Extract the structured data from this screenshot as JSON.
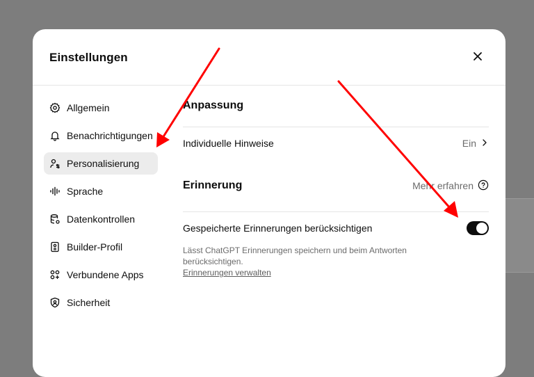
{
  "modal": {
    "title": "Einstellungen"
  },
  "sidebar": {
    "items": [
      {
        "label": "Allgemein",
        "icon": "gear-icon"
      },
      {
        "label": "Benachrichtigungen",
        "icon": "bell-icon"
      },
      {
        "label": "Personalisierung",
        "icon": "user-sliders-icon",
        "active": true
      },
      {
        "label": "Sprache",
        "icon": "waveform-icon"
      },
      {
        "label": "Datenkontrollen",
        "icon": "database-icon"
      },
      {
        "label": "Builder-Profil",
        "icon": "id-card-icon"
      },
      {
        "label": "Verbundene Apps",
        "icon": "apps-grid-icon"
      },
      {
        "label": "Sicherheit",
        "icon": "shield-user-icon"
      }
    ]
  },
  "content": {
    "customization": {
      "title": "Anpassung",
      "custom_instructions_label": "Individuelle Hinweise",
      "custom_instructions_value": "Ein"
    },
    "memory": {
      "title": "Erinnerung",
      "learn_more": "Mehr erfahren",
      "saved_memories_label": "Gespeicherte Erinnerungen berücksichtigen",
      "saved_memories_enabled": true,
      "description": "Lässt ChatGPT Erinnerungen speichern und beim Antworten berücksichtigen.",
      "manage_link": "Erinnerungen verwalten"
    }
  },
  "annotations": {
    "arrow_color": "#ff0000"
  }
}
